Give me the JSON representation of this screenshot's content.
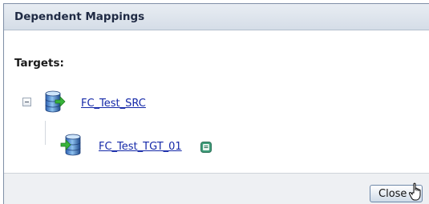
{
  "dialog": {
    "title": "Dependent Mappings",
    "targets_label": "Targets:"
  },
  "tree": {
    "source": {
      "label": "FC_Test_SRC",
      "icon": "database-source-icon",
      "expanded": true
    },
    "targets": [
      {
        "label": "FC_Test_TGT_01",
        "icon": "database-target-icon"
      }
    ]
  },
  "footer": {
    "close_label": "Close"
  },
  "colors": {
    "link": "#1428a8",
    "title_bar": "#dbe2ea",
    "footer": "#eef0f3"
  }
}
